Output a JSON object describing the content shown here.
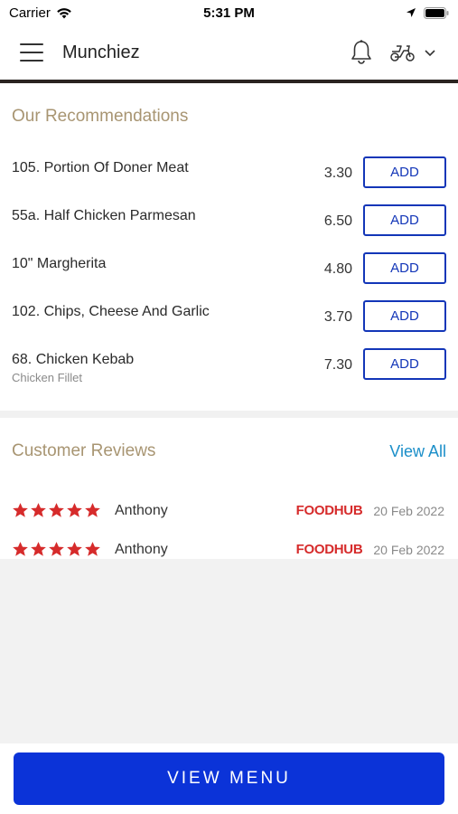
{
  "status_bar": {
    "carrier": "Carrier",
    "time": "5:31 PM"
  },
  "header": {
    "title": "Munchiez",
    "icons": [
      "menu-icon",
      "bell-icon",
      "scooter-icon",
      "chevron-down-icon"
    ]
  },
  "recommendations": {
    "title": "Our Recommendations",
    "items": [
      {
        "name": "105. Portion Of Doner Meat",
        "subtitle": "",
        "price": "3.30",
        "button": "ADD"
      },
      {
        "name": "55a. Half Chicken Parmesan",
        "subtitle": "",
        "price": "6.50",
        "button": "ADD"
      },
      {
        "name": "10\" Margherita",
        "subtitle": "",
        "price": "4.80",
        "button": "ADD"
      },
      {
        "name": "102. Chips, Cheese And Garlic",
        "subtitle": "",
        "price": "3.70",
        "button": "ADD"
      },
      {
        "name": "68. Chicken Kebab",
        "subtitle": "Chicken Fillet",
        "price": "7.30",
        "button": "ADD"
      }
    ]
  },
  "reviews": {
    "title": "Customer Reviews",
    "view_all": "View All",
    "items": [
      {
        "rating": 5,
        "name": "Anthony",
        "source": "FOODHUB",
        "date": "20 Feb 2022"
      },
      {
        "rating": 5,
        "name": "Anthony",
        "source": "FOODHUB",
        "date": "20 Feb 2022"
      }
    ]
  },
  "footer": {
    "button": "VIEW MENU"
  },
  "colors": {
    "accent": "#0b33d8",
    "section_title": "#a89572",
    "link": "#1c8fc9",
    "star": "#d62b2b"
  }
}
